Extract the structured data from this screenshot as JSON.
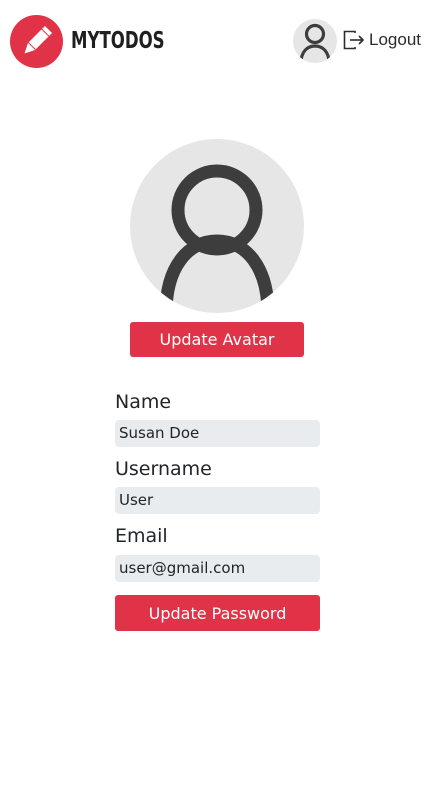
{
  "header": {
    "brand": "MYTODOS",
    "logout_label": "Logout"
  },
  "profile": {
    "update_avatar_label": "Update Avatar",
    "fields": [
      {
        "label": "Name",
        "value": "Susan Doe"
      },
      {
        "label": "Username",
        "value": "User"
      },
      {
        "label": "Email",
        "value": "user@gmail.com"
      }
    ],
    "update_password_label": "Update Password"
  },
  "colors": {
    "accent": "#e03347",
    "avatar_bg": "#e6e6e6",
    "field_bg": "#e9ecef",
    "icon_dark": "#3d3d3d"
  },
  "icons": {
    "logo": "pencil-icon",
    "nav_avatar": "user-icon",
    "logout": "logout-icon",
    "profile_avatar": "user-icon"
  }
}
